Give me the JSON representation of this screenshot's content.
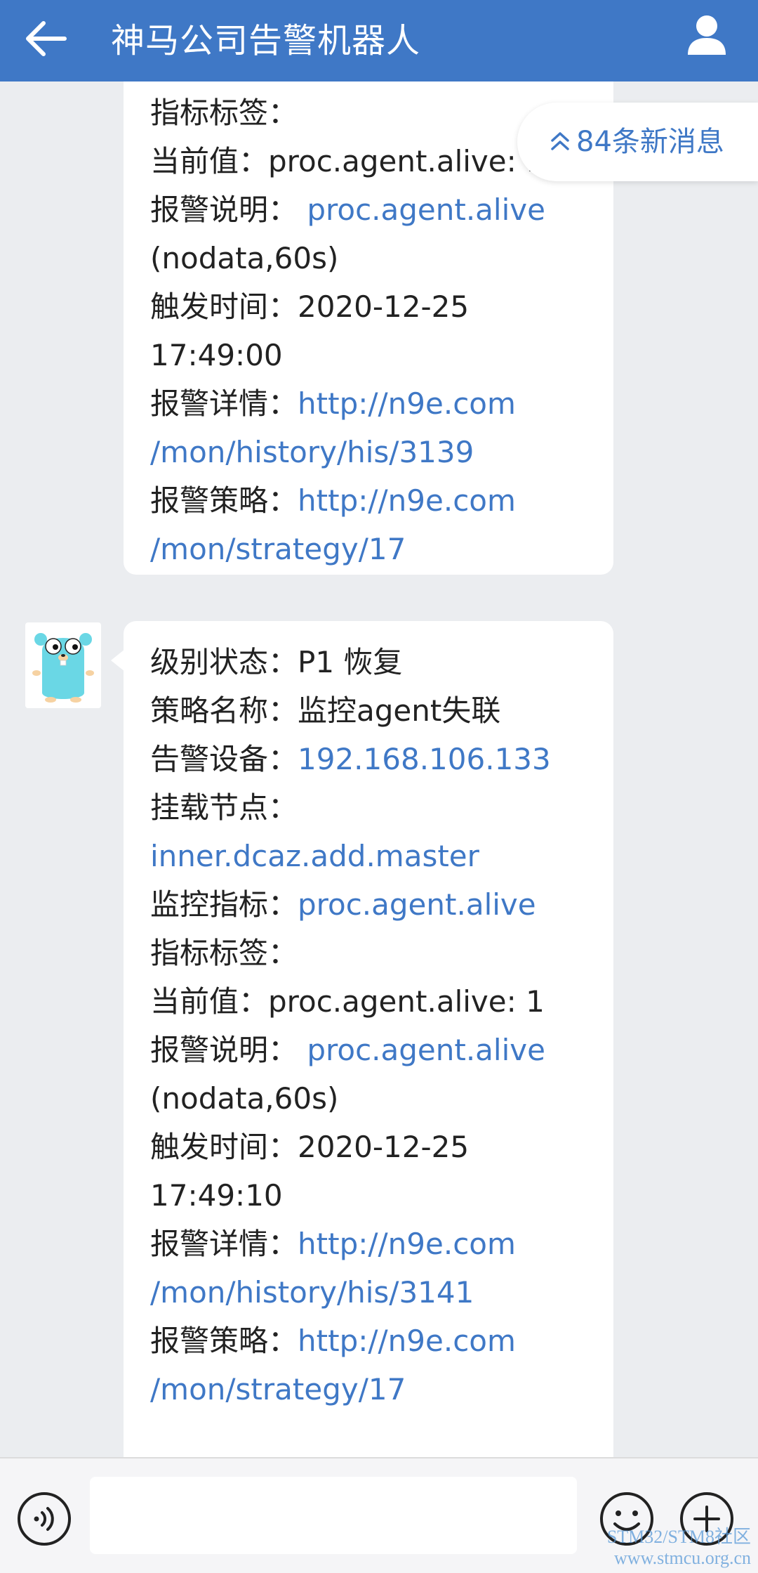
{
  "header": {
    "title": "神马公司告警机器人",
    "back_icon": "arrow-left-icon",
    "profile_icon": "person-icon"
  },
  "new_messages": {
    "label": "84条新消息",
    "icon": "double-chevron-up-icon"
  },
  "message1": {
    "lines": [
      {
        "label": "指标标签：",
        "value": ""
      },
      {
        "label": "当前值：",
        "value": "proc.agent.alive: 1"
      },
      {
        "label": "报警说明：",
        "value": " proc.agent.alive",
        "link": true
      },
      {
        "label": "",
        "value": "(nodata,60s)"
      },
      {
        "label": "触发时间：",
        "value": "2020-12-25"
      },
      {
        "label": "",
        "value": "17:49:00"
      },
      {
        "label": "报警详情：",
        "value": "http://n9e.com",
        "link": true
      },
      {
        "label": "",
        "value": "/mon/history/his/3139",
        "link": true
      },
      {
        "label": "报警策略：",
        "value": "http://n9e.com",
        "link": true
      },
      {
        "label": "",
        "value": "/mon/strategy/17",
        "link": true
      }
    ]
  },
  "message2": {
    "lines": [
      {
        "label": "级别状态：",
        "value": "P1 恢复"
      },
      {
        "label": "策略名称：",
        "value": "监控agent失联"
      },
      {
        "label": "告警设备：",
        "value": "192.168.106.133",
        "link": true
      },
      {
        "label": "挂载节点：",
        "value": ""
      },
      {
        "label": "",
        "value": "inner.dcaz.add.master",
        "link": true
      },
      {
        "label": "监控指标：",
        "value": "proc.agent.alive",
        "link": true
      },
      {
        "label": "指标标签：",
        "value": ""
      },
      {
        "label": "当前值：",
        "value": "proc.agent.alive: 1"
      },
      {
        "label": "报警说明：",
        "value": " proc.agent.alive",
        "link": true
      },
      {
        "label": "",
        "value": "(nodata,60s)"
      },
      {
        "label": "触发时间：",
        "value": "2020-12-25"
      },
      {
        "label": "",
        "value": "17:49:10"
      },
      {
        "label": "报警详情：",
        "value": "http://n9e.com",
        "link": true
      },
      {
        "label": "",
        "value": "/mon/history/his/3141",
        "link": true
      },
      {
        "label": "报警策略：",
        "value": "http://n9e.com",
        "link": true
      },
      {
        "label": "",
        "value": "/mon/strategy/17",
        "link": true
      }
    ]
  },
  "input_bar": {
    "voice_icon": "voice-icon",
    "emoji_icon": "emoji-icon",
    "plus_icon": "plus-icon",
    "text": ""
  },
  "watermark": {
    "line1": "STM32/STM8社区",
    "line2": "www.stmcu.org.cn"
  },
  "colors": {
    "header": "#3f78c6",
    "link": "#3f78c6",
    "background": "#ebedf0"
  }
}
